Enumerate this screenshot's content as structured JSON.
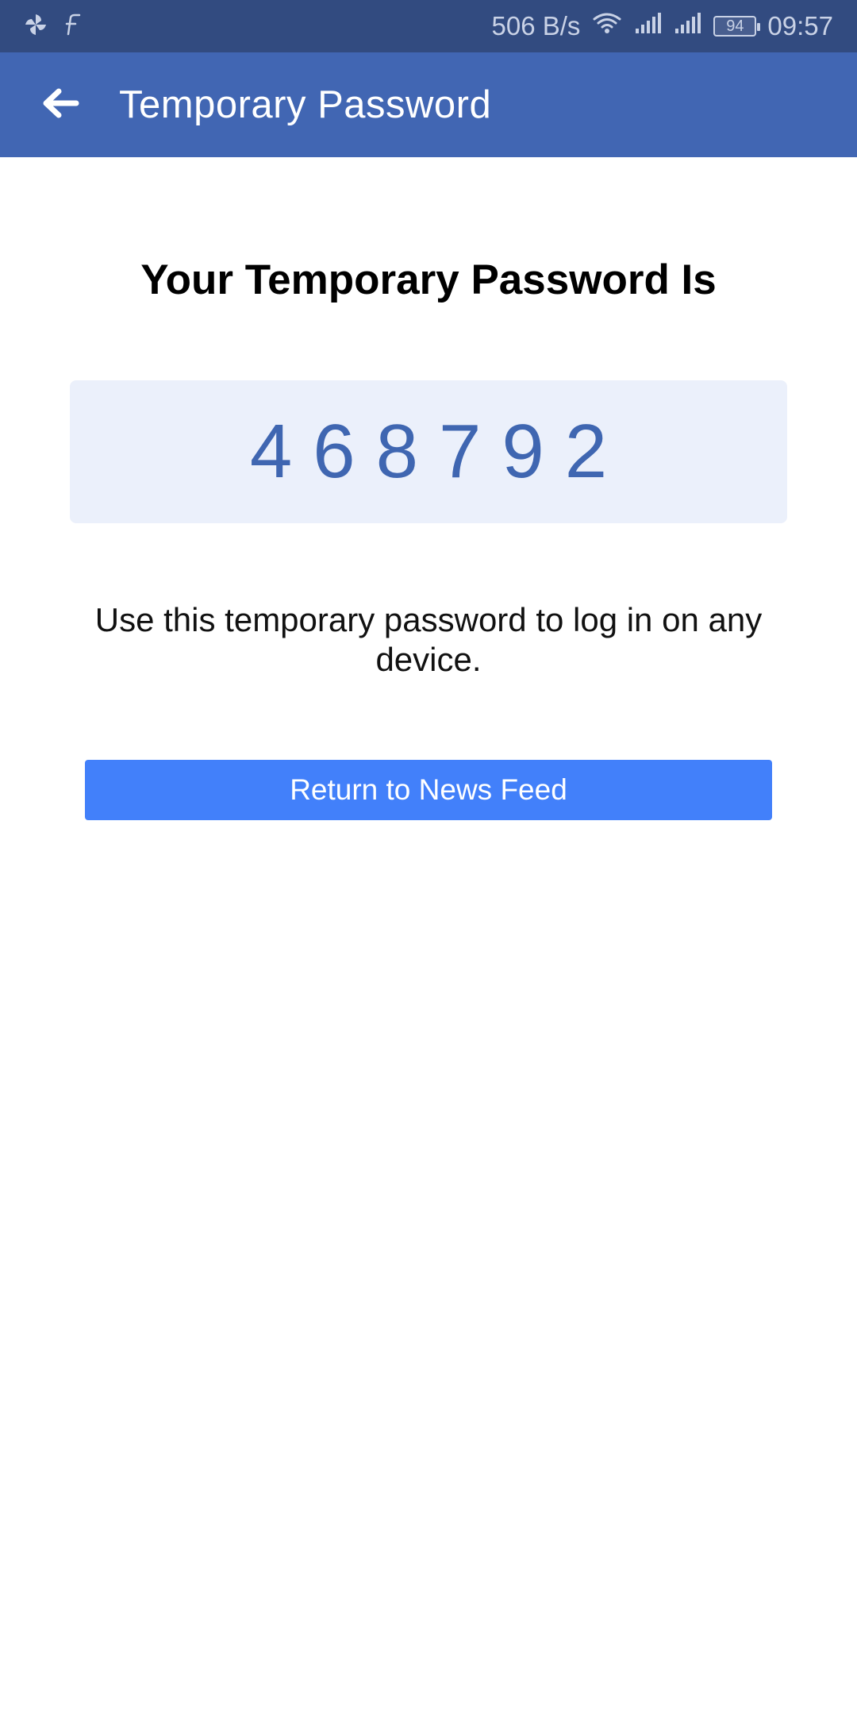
{
  "status_bar": {
    "network_speed": "506 B/s",
    "battery_level": "94",
    "time": "09:57",
    "left_icons": [
      "pinwheel-icon",
      "f-icon"
    ],
    "right_icons": [
      "wifi-icon",
      "signal-icon",
      "signal-icon",
      "battery-icon"
    ],
    "background_color": "#324b80"
  },
  "app_bar": {
    "title": "Temporary Password",
    "back_icon": "arrow-left-icon",
    "background_color": "#4166b3"
  },
  "main": {
    "heading": "Your Temporary Password Is",
    "code": "468792",
    "info_text": "Use this temporary password to log in on any device.",
    "button_label": "Return to News Feed",
    "button_color": "#4280fa",
    "code_color": "#3f66b1"
  }
}
